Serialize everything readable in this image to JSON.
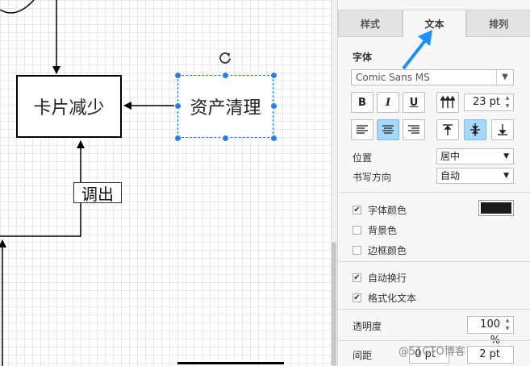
{
  "canvas": {
    "box_card": "卡片减少",
    "box_asset": "资产清理",
    "label_tiaochu": "调出"
  },
  "panel": {
    "tabs": [
      {
        "label": "样式"
      },
      {
        "label": "文本"
      },
      {
        "label": "排列"
      }
    ],
    "active_tab": "文本",
    "font_section": "字体",
    "font_family": "Comic Sans MS",
    "bold_label": "B",
    "italic_label": "I",
    "underline_label": "U",
    "font_size": "23 pt",
    "position_label": "位置",
    "position_value": "居中",
    "writing_dir_label": "书写方向",
    "writing_dir_value": "自动",
    "font_color_label": "字体颜色",
    "font_color_checked": true,
    "font_color": "#1a1a1a",
    "bg_color_label": "背景色",
    "border_color_label": "边框颜色",
    "auto_wrap_label": "自动换行",
    "formatted_text_label": "格式化文本",
    "opacity_label": "透明度",
    "opacity_value": "100 %",
    "spacing_label": "间距",
    "spacing_value_1": "0 pt",
    "spacing_value_2": "2 pt"
  },
  "colors": {
    "selection_blue": "#2b7de9",
    "selected_button": "#a6d8fb",
    "callout_arrow": "#1e90ff"
  },
  "watermark": "@51CTO博客"
}
